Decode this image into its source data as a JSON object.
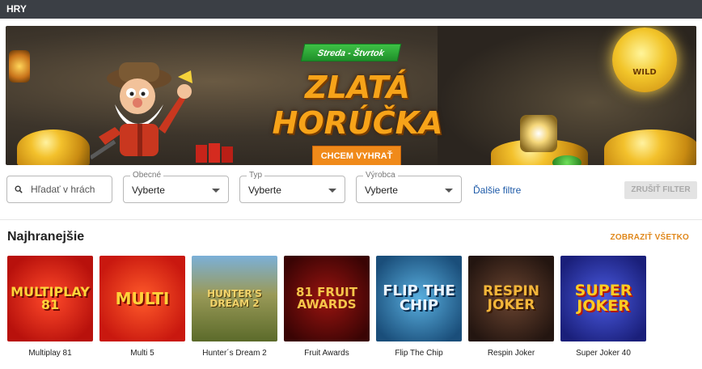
{
  "header": {
    "title": "HRY"
  },
  "banner": {
    "ribbon": "Streda - Štvrtok",
    "headline": "ZLATÁ HORÚČKA",
    "cta_label": "CHCEM VYHRAŤ",
    "wild_label": "WILD",
    "slides": 4,
    "active_slide": 3
  },
  "filters": {
    "search_placeholder": "Hľadať v hrách",
    "selects": [
      {
        "legend": "Obecné",
        "value": "Vyberte"
      },
      {
        "legend": "Typ",
        "value": "Vyberte"
      },
      {
        "legend": "Výrobca",
        "value": "Vyberte"
      }
    ],
    "more_label": "Ďalšie filtre",
    "clear_label": "ZRUŠIŤ FILTER"
  },
  "section": {
    "title": "Najhranejšie",
    "show_all": "ZOBRAZIŤ VŠETKO"
  },
  "games": [
    {
      "name": "Multiplay 81",
      "art": "MULTIPLAY 81",
      "bg": "#d21b14",
      "fg": "#ffd43a"
    },
    {
      "name": "Multi 5",
      "art": "MULTI",
      "bg": "#e0281e",
      "fg": "#ffd23a"
    },
    {
      "name": "Hunter´s Dream 2",
      "art": "HUNTER'S DREAM 2",
      "bg": "#8a7a3a",
      "fg": "#f2d36a"
    },
    {
      "name": "Fruit Awards",
      "art": "81 FRUIT AWARDS",
      "bg": "#5a0606",
      "fg": "#f6c64a"
    },
    {
      "name": "Flip The Chip",
      "art": "FLIP THE CHIP",
      "bg": "#1f5f8f",
      "fg": "#eaf4ff"
    },
    {
      "name": "Respin Joker",
      "art": "RESPIN JOKER",
      "bg": "#3c2418",
      "fg": "#f3b63a"
    },
    {
      "name": "Super Joker 40",
      "art": "SUPER JOKER",
      "bg": "#2a2fa8",
      "fg": "#ffcc22"
    }
  ]
}
